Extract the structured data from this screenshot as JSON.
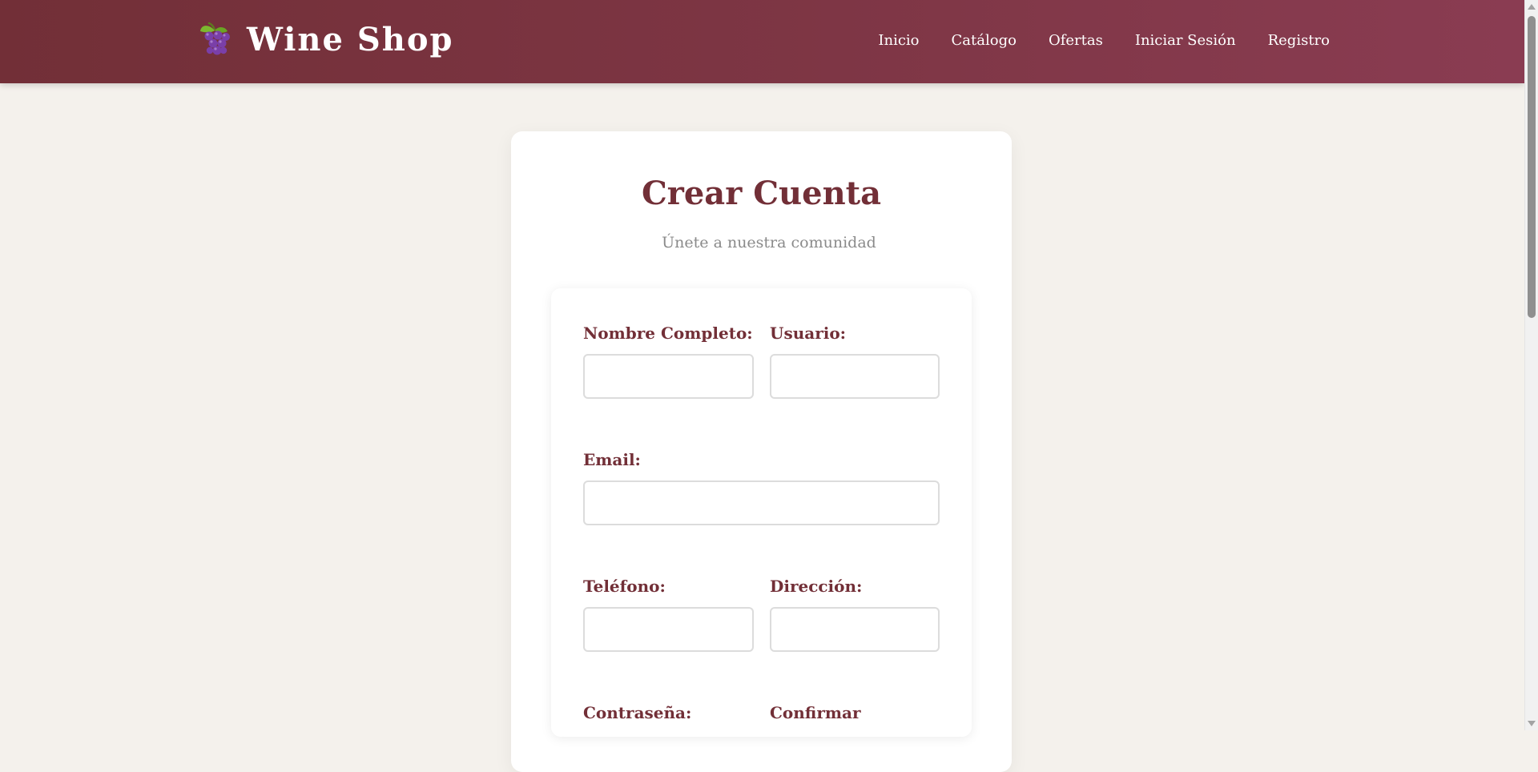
{
  "header": {
    "brand_name": "Wine Shop",
    "brand_icon": "grapes-icon",
    "nav": [
      {
        "label": "Inicio"
      },
      {
        "label": "Catálogo"
      },
      {
        "label": "Ofertas"
      },
      {
        "label": "Iniciar Sesión"
      },
      {
        "label": "Registro"
      }
    ]
  },
  "register": {
    "title": "Crear Cuenta",
    "subtitle": "Únete a nuestra comunidad",
    "fields": {
      "full_name": {
        "label": "Nombre Completo:",
        "value": ""
      },
      "username": {
        "label": "Usuario:",
        "value": ""
      },
      "email": {
        "label": "Email:",
        "value": ""
      },
      "phone": {
        "label": "Teléfono:",
        "value": ""
      },
      "address": {
        "label": "Dirección:",
        "value": ""
      },
      "password": {
        "label": "Contraseña:",
        "value": ""
      },
      "confirm": {
        "label": "Confirmar",
        "value": ""
      }
    }
  },
  "colors": {
    "brand": "#722f37",
    "brand_light": "#8a3c52",
    "background": "#f4f1ec",
    "muted_text": "#8a8a8a"
  }
}
